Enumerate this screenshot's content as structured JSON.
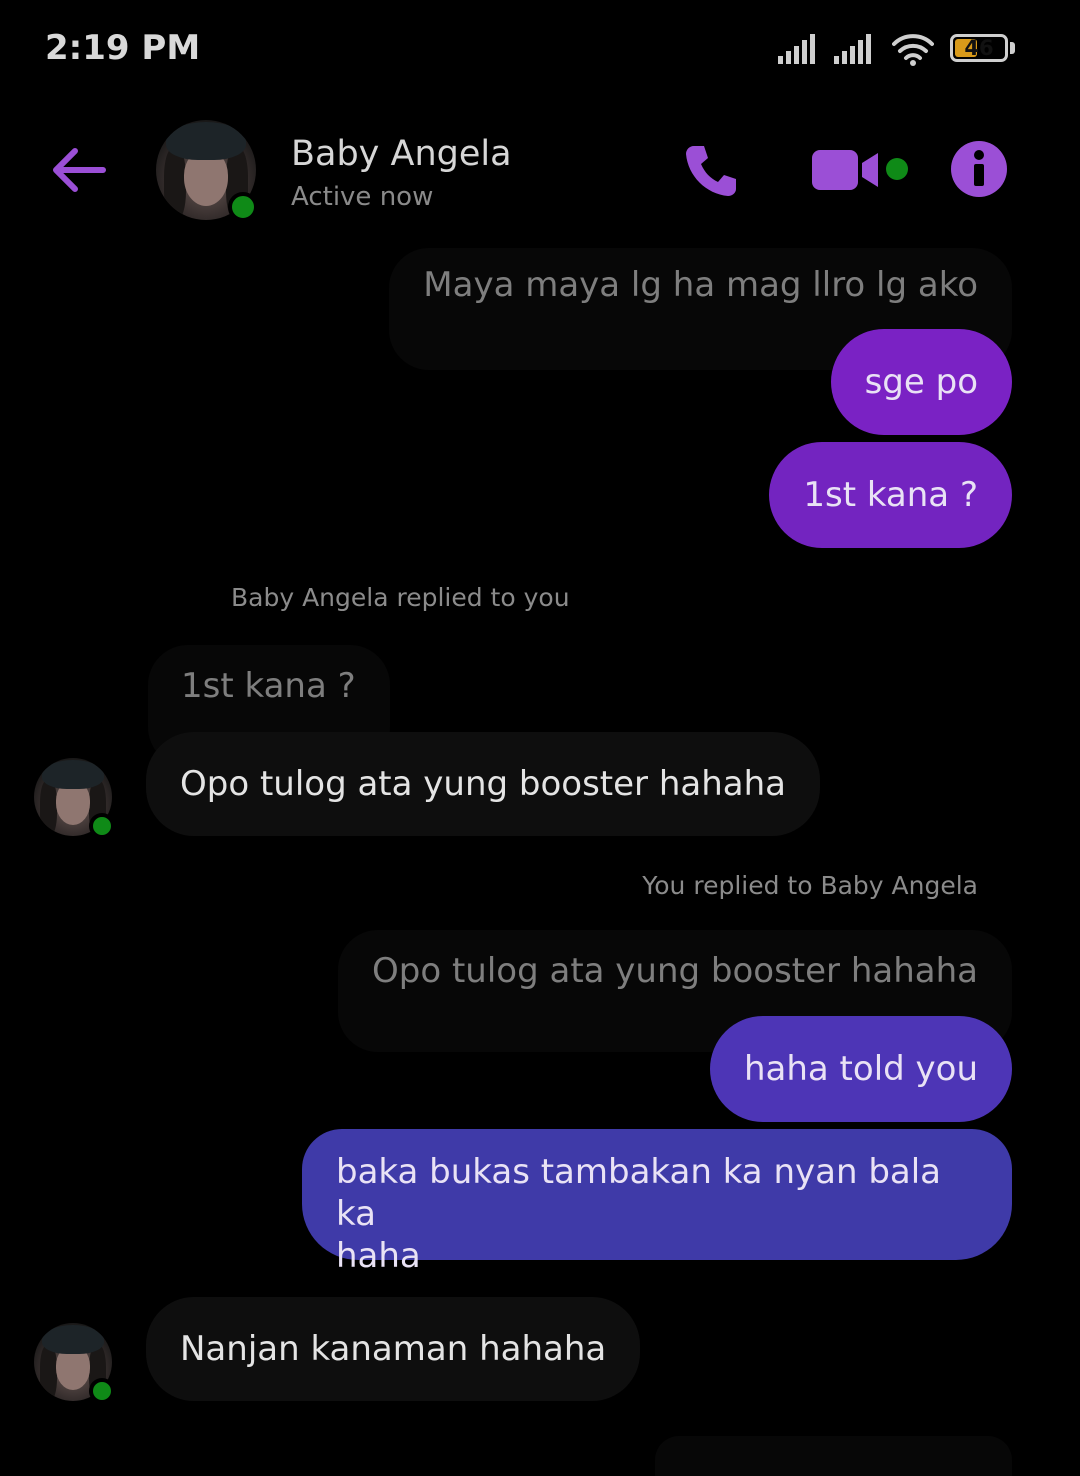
{
  "status_bar": {
    "time": "2:19 PM",
    "battery": "46",
    "battery_level": 0.46,
    "icons": [
      "signal-icon",
      "signal-icon",
      "wifi-icon",
      "battery-icon"
    ]
  },
  "header": {
    "contact_name": "Baby Angela",
    "contact_status": "Active now",
    "icons": [
      "back-arrow-icon",
      "phone-icon",
      "video-camera-icon",
      "info-icon"
    ]
  },
  "messages": [
    {
      "text": "Maya maya lg ha mag llro lg ako",
      "direction": "quoted-outgoing"
    },
    {
      "text": "sge po",
      "direction": "outgoing"
    },
    {
      "text": "1st kana ?",
      "direction": "outgoing"
    },
    {
      "reply_label": "Baby Angela replied to you"
    },
    {
      "text": "1st kana ?",
      "direction": "quoted-incoming"
    },
    {
      "text": "Opo tulog ata yung booster hahaha",
      "direction": "incoming"
    },
    {
      "reply_label": "You replied to Baby Angela"
    },
    {
      "text": "Opo tulog ata yung booster hahaha",
      "direction": "quoted-outgoing"
    },
    {
      "text": "haha told you",
      "direction": "outgoing"
    },
    {
      "text_line1": "baka bukas tambakan ka nyan bala ka",
      "text_line2": "haha",
      "direction": "outgoing"
    },
    {
      "text": "Nanjan kanaman hahaha",
      "direction": "incoming"
    }
  ],
  "colors": {
    "accent": "#9b4fd6",
    "bubble_purple": "#7a22c4",
    "bubble_indigo": "#3f3aa8",
    "online": "#0f8a17",
    "background": "#000000"
  }
}
